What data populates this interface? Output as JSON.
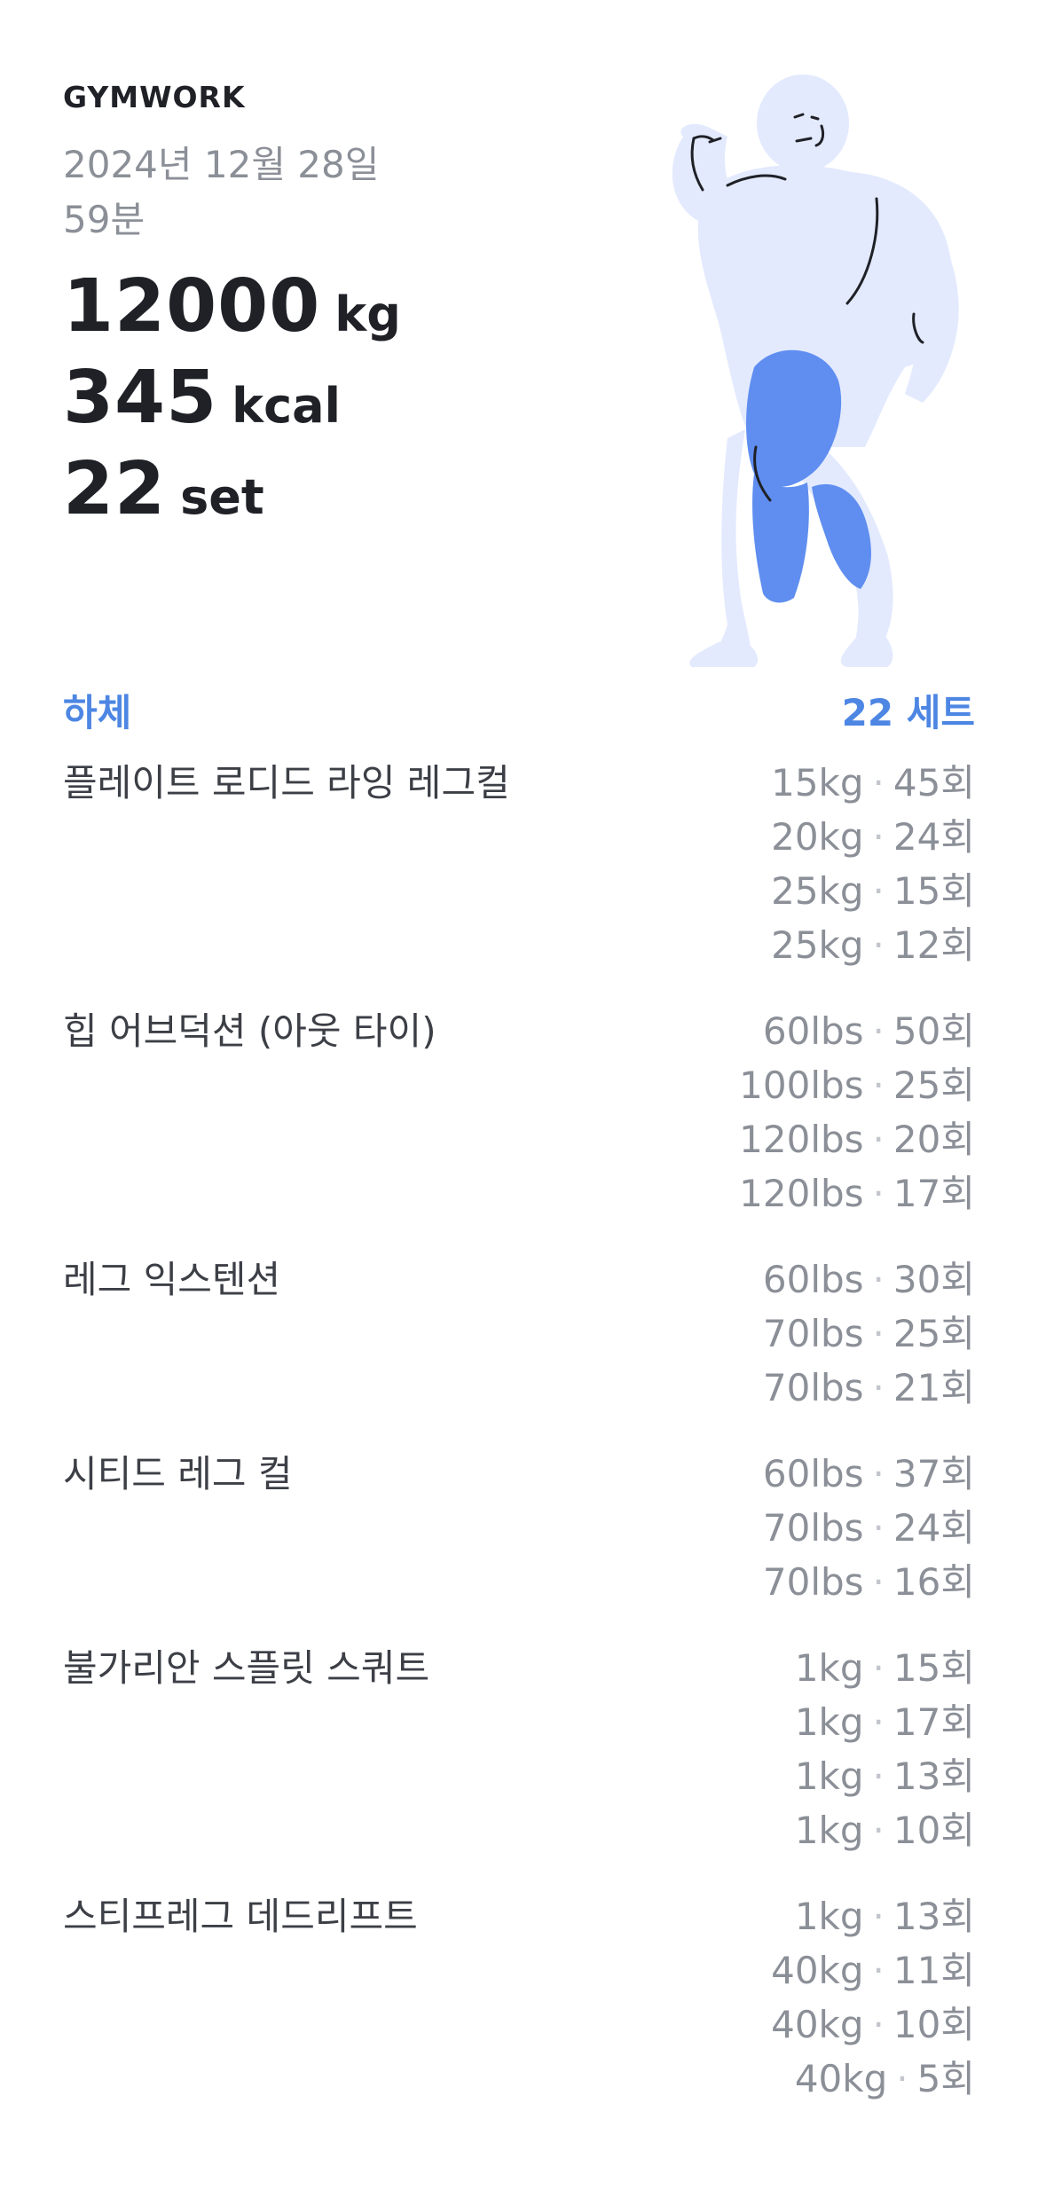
{
  "brand": {
    "logo_text": "GYMWORK"
  },
  "summary": {
    "date": "2024년 12월 28일",
    "duration": "59분",
    "stats": [
      {
        "value": "12000",
        "unit": "kg"
      },
      {
        "value": "345",
        "unit": "kcal"
      },
      {
        "value": "22",
        "unit": "set"
      }
    ]
  },
  "figure": {
    "icon": "muscle-figure-icon",
    "highlight_color": "#5f8ef0",
    "base_color": "#e3eafe"
  },
  "section": {
    "title": "하체",
    "count": "22 세트"
  },
  "exercises": [
    {
      "name": "플레이트 로디드 라잉 레그컬",
      "sets": [
        {
          "weight": "15kg",
          "reps": "45회"
        },
        {
          "weight": "20kg",
          "reps": "24회"
        },
        {
          "weight": "25kg",
          "reps": "15회"
        },
        {
          "weight": "25kg",
          "reps": "12회"
        }
      ]
    },
    {
      "name": "힙 어브덕션 (아웃 타이)",
      "sets": [
        {
          "weight": "60lbs",
          "reps": "50회"
        },
        {
          "weight": "100lbs",
          "reps": "25회"
        },
        {
          "weight": "120lbs",
          "reps": "20회"
        },
        {
          "weight": "120lbs",
          "reps": "17회"
        }
      ]
    },
    {
      "name": "레그 익스텐션",
      "sets": [
        {
          "weight": "60lbs",
          "reps": "30회"
        },
        {
          "weight": "70lbs",
          "reps": "25회"
        },
        {
          "weight": "70lbs",
          "reps": "21회"
        }
      ]
    },
    {
      "name": "시티드 레그 컬",
      "sets": [
        {
          "weight": "60lbs",
          "reps": "37회"
        },
        {
          "weight": "70lbs",
          "reps": "24회"
        },
        {
          "weight": "70lbs",
          "reps": "16회"
        }
      ]
    },
    {
      "name": "불가리안 스플릿 스쿼트",
      "sets": [
        {
          "weight": "1kg",
          "reps": "15회"
        },
        {
          "weight": "1kg",
          "reps": "17회"
        },
        {
          "weight": "1kg",
          "reps": "13회"
        },
        {
          "weight": "1kg",
          "reps": "10회"
        }
      ]
    },
    {
      "name": "스티프레그 데드리프트",
      "sets": [
        {
          "weight": "1kg",
          "reps": "13회"
        },
        {
          "weight": "40kg",
          "reps": "11회"
        },
        {
          "weight": "40kg",
          "reps": "10회"
        },
        {
          "weight": "40kg",
          "reps": "5회"
        }
      ]
    }
  ],
  "separator": "·"
}
